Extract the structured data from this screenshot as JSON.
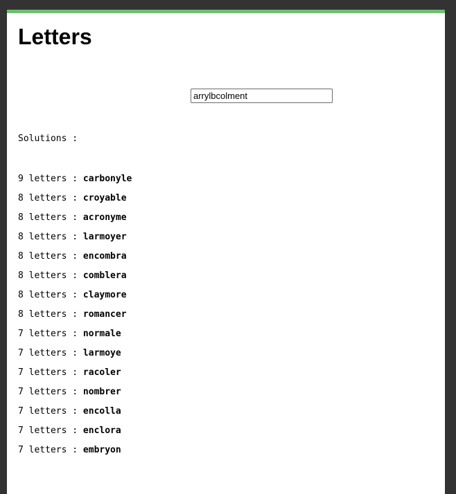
{
  "page": {
    "title": "Letters"
  },
  "input": {
    "value": "arrylbcolment"
  },
  "solutions": {
    "label": "Solutions :",
    "items": [
      {
        "count_label": "9 letters : ",
        "word": "carbonyle"
      },
      {
        "count_label": "8 letters : ",
        "word": "croyable"
      },
      {
        "count_label": "8 letters : ",
        "word": "acronyme"
      },
      {
        "count_label": "8 letters : ",
        "word": "larmoyer"
      },
      {
        "count_label": "8 letters : ",
        "word": "encombra"
      },
      {
        "count_label": "8 letters : ",
        "word": "comblera"
      },
      {
        "count_label": "8 letters : ",
        "word": "claymore"
      },
      {
        "count_label": "8 letters : ",
        "word": "romancer"
      },
      {
        "count_label": "7 letters : ",
        "word": "normale"
      },
      {
        "count_label": "7 letters : ",
        "word": "larmoye"
      },
      {
        "count_label": "7 letters : ",
        "word": "racoler"
      },
      {
        "count_label": "7 letters : ",
        "word": "nombrer"
      },
      {
        "count_label": "7 letters : ",
        "word": "encolla"
      },
      {
        "count_label": "7 letters : ",
        "word": "enclora"
      },
      {
        "count_label": "7 letters : ",
        "word": "embryon"
      }
    ]
  },
  "colors": {
    "accent_bar": "#6cc070",
    "frame": "#333333",
    "page_background": "#ffffff"
  }
}
